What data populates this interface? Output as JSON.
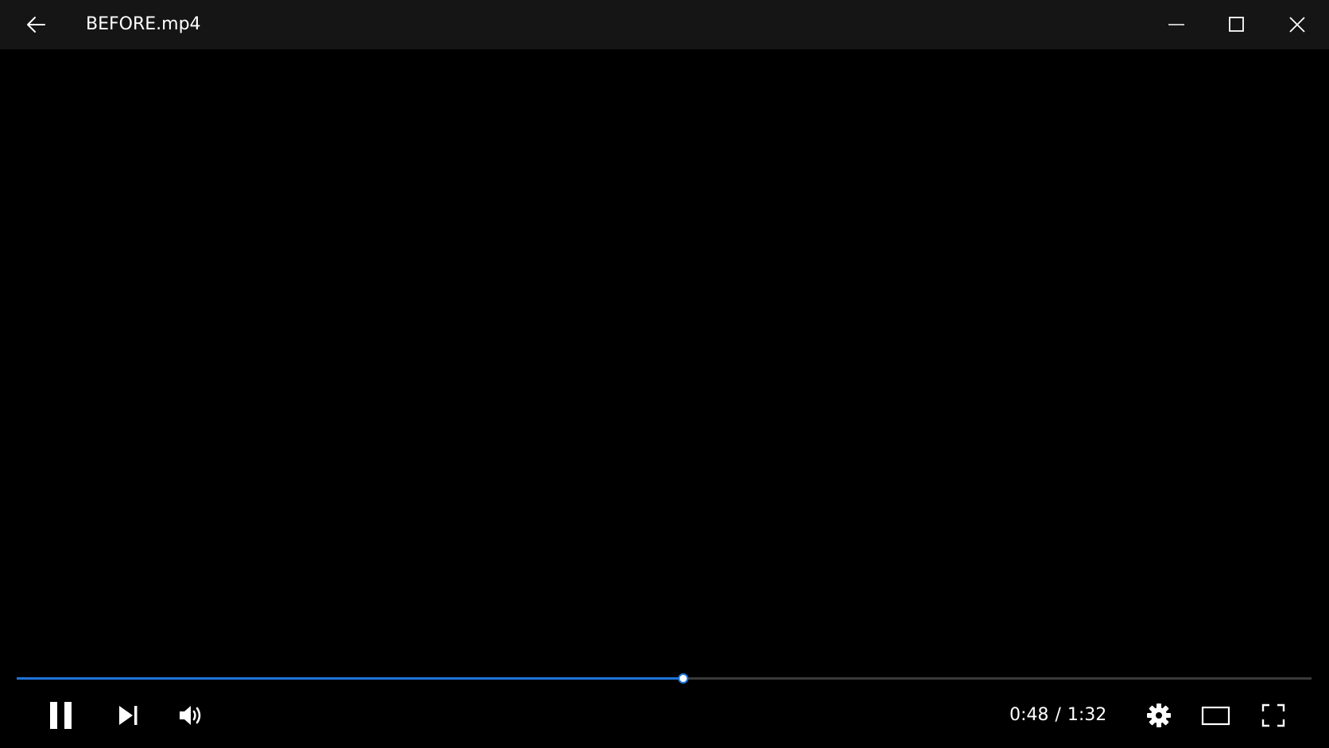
{
  "window": {
    "title": "BEFORE.mp4"
  },
  "icons": {
    "back": "arrow-left-icon",
    "minimize": "minimize-icon",
    "maximize": "maximize-icon",
    "close": "close-icon",
    "pause": "pause-icon",
    "next": "skip-next-icon",
    "volume": "volume-icon",
    "settings": "gear-icon",
    "aspect": "aspect-ratio-icon",
    "fullscreen": "fullscreen-icon"
  },
  "playback": {
    "current_time": "0:48",
    "separator": "/",
    "total_time": "1:32",
    "progress_fraction": 0.515
  },
  "colors": {
    "accent": "#1e74d9",
    "titlebar_bg": "#151515",
    "video_bg": "#000000",
    "track": "#3a3a3a",
    "text": "#ffffff"
  }
}
